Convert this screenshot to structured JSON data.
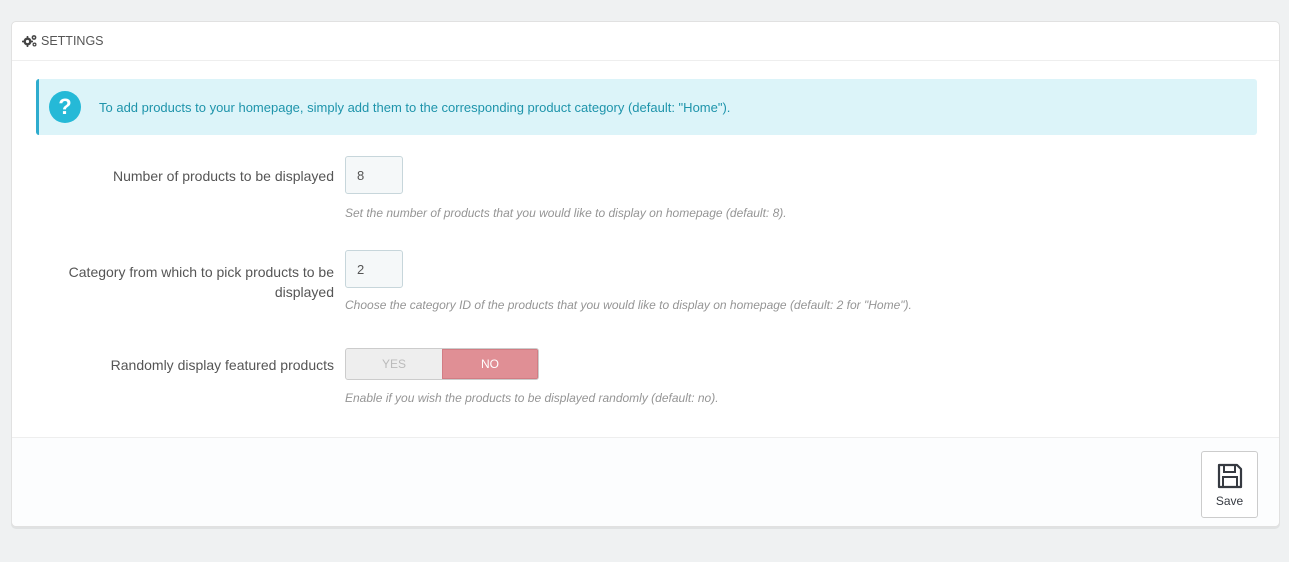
{
  "panel": {
    "title": "SETTINGS",
    "title_icon": "cogs-icon"
  },
  "alert": {
    "icon": "question-icon",
    "icon_glyph": "?",
    "text": "To add products to your homepage, simply add them to the corresponding product category (default: \"Home\")."
  },
  "fields": {
    "nb_products": {
      "label": "Number of products to be displayed",
      "value": "8",
      "help": "Set the number of products that you would like to display on homepage (default: 8)."
    },
    "category": {
      "label": "Category from which to pick products to be displayed",
      "value": "2",
      "help": "Choose the category ID of the products that you would like to display on homepage (default: 2 for \"Home\")."
    },
    "random": {
      "label": "Randomly display featured products",
      "yes_label": "YES",
      "no_label": "NO",
      "selected": "NO",
      "help": "Enable if you wish the products to be displayed randomly (default: no)."
    }
  },
  "footer": {
    "save_label": "Save",
    "save_icon": "floppy-disk-icon"
  },
  "colors": {
    "alert_bg": "#dcf4f9",
    "alert_text": "#1e94ab",
    "switch_active": "#e08f95"
  }
}
